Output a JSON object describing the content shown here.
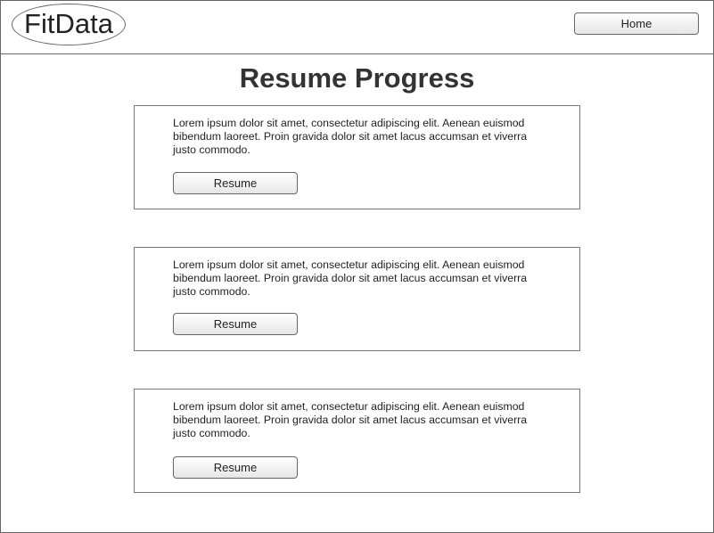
{
  "header": {
    "logo": "FitData",
    "home_label": "Home"
  },
  "page": {
    "title": "Resume Progress"
  },
  "cards": [
    {
      "text": "Lorem ipsum dolor sit amet, consectetur adipiscing elit. Aenean euismod bibendum laoreet. Proin gravida dolor sit amet lacus accumsan et viverra justo commodo.",
      "button": "Resume"
    },
    {
      "text": "Lorem ipsum dolor sit amet, consectetur adipiscing elit. Aenean euismod bibendum laoreet. Proin gravida dolor sit amet lacus accumsan et viverra justo commodo.",
      "button": "Resume"
    },
    {
      "text": "Lorem ipsum dolor sit amet, consectetur adipiscing elit. Aenean euismod bibendum laoreet. Proin gravida dolor sit amet lacus accumsan et viverra justo commodo.",
      "button": "Resume"
    }
  ]
}
